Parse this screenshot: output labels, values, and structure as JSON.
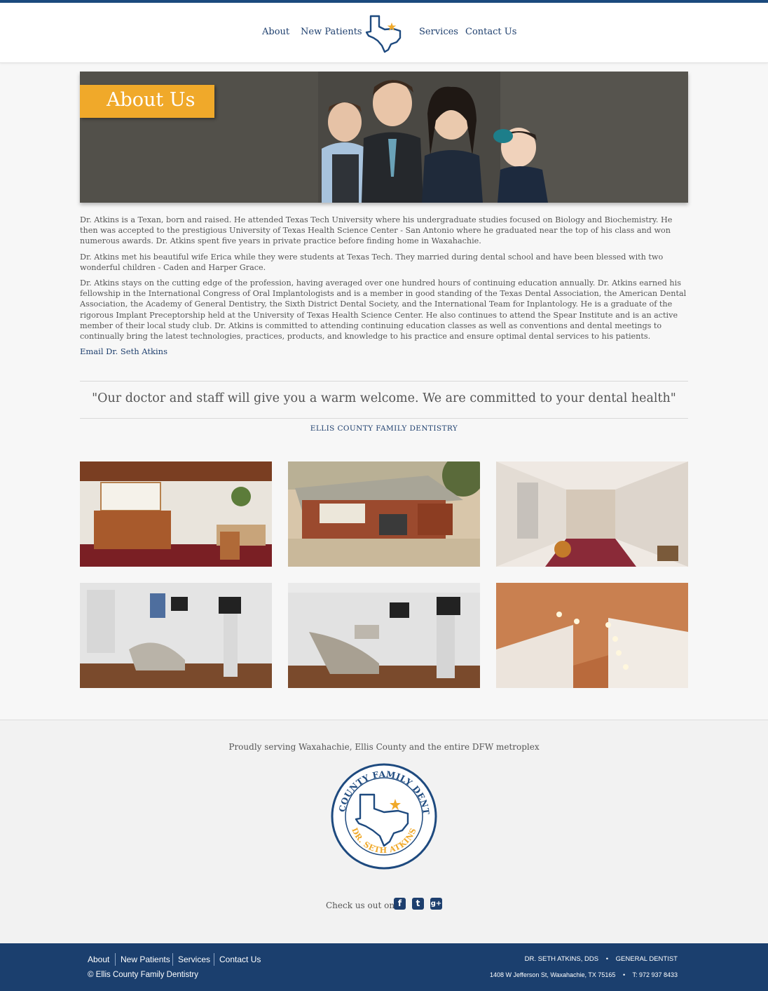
{
  "nav": {
    "items": [
      {
        "label": "About"
      },
      {
        "label": "New Patients"
      },
      {
        "label": "Services"
      },
      {
        "label": "Contact Us"
      }
    ],
    "logo_icon": "texas-star-icon"
  },
  "hero": {
    "title": "About Us"
  },
  "bio": {
    "paragraphs": [
      "Dr. Atkins is a Texan, born and raised. He attended Texas Tech University where his undergraduate studies focused on Biology and Biochemistry. He then was accepted to the prestigious University of Texas Health Science Center - San Antonio where he graduated near the top of his class and won numerous awards. Dr. Atkins spent five years in private practice before finding home in Waxahachie.",
      "Dr. Atkins met his beautiful wife Erica while they were students at Texas Tech. They married during dental school and have been blessed with two wonderful children - Caden and Harper Grace.",
      "Dr. Atkins stays on the cutting edge of the profession, having averaged over one hundred hours of continuing education annually. Dr. Atkins earned his fellowship in the International Congress of Oral Implantologists and is a member in good standing of the Texas Dental Association, the American Dental Association, the Academy of General Dentistry, the Sixth District Dental Society, and the International Team for Inplantology. He is a graduate of the rigorous Implant Preceptorship held at the University of Texas Health Science Center. He also continues to attend the Spear Institute and is an active member of their local study club. Dr. Atkins is committed to attending continuing education classes as well as conventions and dental meetings to continually bring the latest technologies, practices, products, and knowledge to his practice and ensure optimal dental services to his patients."
    ],
    "email_link": "Email Dr. Seth Atkins"
  },
  "quote": {
    "text": "\"Our doctor and staff will give you a warm welcome. We are committed to your dental health\"",
    "source": "ELLIS COUNTY FAMILY DENTISTRY"
  },
  "footer": {
    "serving": "Proudly serving Waxahachie, Ellis County and the entire DFW metroplex",
    "seal_ring_top": "ELLIS COUNTY FAMILY DENTISTRY",
    "seal_ring_bottom": "DR. SETH ATKINS",
    "check_us": "Check us out on:",
    "social": [
      {
        "icon": "facebook-icon",
        "glyph": "f"
      },
      {
        "icon": "twitter-icon",
        "glyph": "t"
      },
      {
        "icon": "google-plus-icon",
        "glyph": "g+"
      }
    ],
    "nav": [
      {
        "label": "About"
      },
      {
        "label": "New Patients"
      },
      {
        "label": "Services"
      },
      {
        "label": "Contact Us"
      }
    ],
    "copyright": "© Ellis County Family Dentistry",
    "doctor": "DR. SETH ATKINS, DDS",
    "role": "GENERAL DENTIST",
    "address": "1408 W Jefferson St, Waxahachie, TX 75165",
    "phone": "T: 972 937 8433",
    "bullet": "•"
  },
  "colors": {
    "navy": "#1b3f6e",
    "accent_orange": "#f0a92a",
    "text": "#555555",
    "link": "#1e3f6e"
  }
}
